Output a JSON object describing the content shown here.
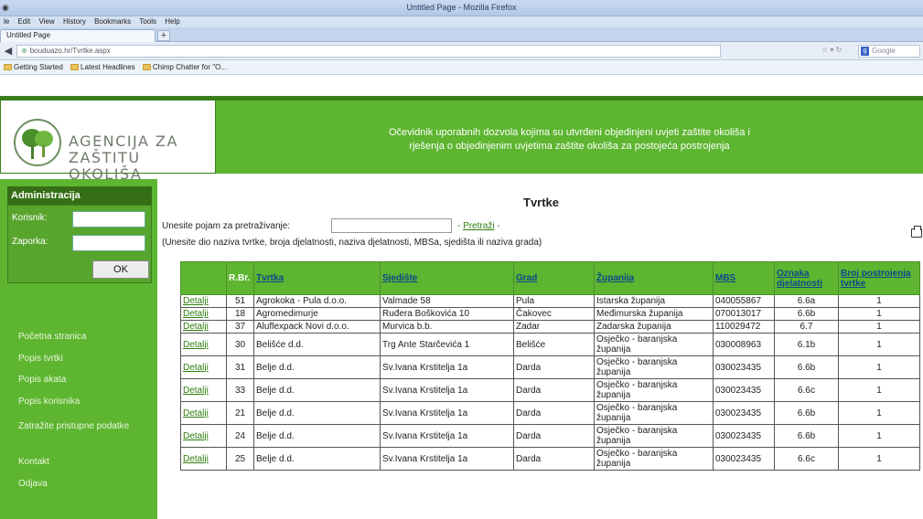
{
  "browser": {
    "window_title": "Untitled Page - Mozilla Firefox",
    "menu": [
      "le",
      "Edit",
      "View",
      "History",
      "Bookmarks",
      "Tools",
      "Help"
    ],
    "tab_label": "Untitled Page",
    "new_tab_label": "+",
    "url": "bouduazo.hr/Tvrtke.aspx",
    "search_engine": "Google",
    "bookmarks": [
      "Getting Started",
      "Latest Headlines",
      "Chimp Chatter for \"O..."
    ]
  },
  "header": {
    "logo_line1": "AGENCIJA ZA",
    "logo_line2": "ZAŠTITU OKOLIŠA",
    "banner_line1": "Očevidnik uporabnih dozvola kojima su utvrđeni objedinjeni uvjeti zaštite okoliša i",
    "banner_line2": "rješenja o objedinjenim uvjetima zaštite okoliša za postojeća postrojenja"
  },
  "sidebar": {
    "admin_title": "Administracija",
    "user_label": "Korisnik:",
    "password_label": "Zaporka:",
    "ok_label": "OK",
    "nav": [
      "Početna stranica",
      "Popis tvrtki",
      "Popis akata",
      "Popis korisnika",
      "Zatražite pristupne podatke",
      "Kontakt",
      "Odjava"
    ]
  },
  "main": {
    "title": "Tvrtke",
    "search_prompt": "Unesite pojam za pretraživanje:",
    "search_button": "Pretraži",
    "search_hint": "(Unesite dio naziva tvrtke, broja djelatnosti, naziva djelatnosti, MBSa, sjedišta ili naziva grada)"
  },
  "table": {
    "headers": [
      "",
      "R.Br.",
      "Tvrtka",
      "Sjedište",
      "Grad",
      "Županija",
      "MBS",
      "Oznaka djelatnosti",
      "Broj postrojenja tvrtke"
    ],
    "rows": [
      [
        "Detalji",
        "51",
        "Agrokoka - Pula d.o.o.",
        "Valmade 58",
        "Pula",
        "Istarska županija",
        "040055867",
        "6.6a",
        "1"
      ],
      [
        "Detalji",
        "18",
        "Agromedimurje",
        "Ruđera Boškovića 10",
        "Čakovec",
        "Međimurska županija",
        "070013017",
        "6.6b",
        "1"
      ],
      [
        "Detalji",
        "37",
        "Aluflexpack Novi d.o.o.",
        "Murvica b.b.",
        "Zadar",
        "Zadarska županija",
        "110029472",
        "6.7",
        "1"
      ],
      [
        "Detalji",
        "30",
        "Belišće d.d.",
        "Trg Ante Starčevića 1",
        "Belišće",
        "Osječko - baranjska županija",
        "030008963",
        "6.1b",
        "1"
      ],
      [
        "Detalji",
        "31",
        "Belje d.d.",
        "Sv.Ivana Krstitelja 1a",
        "Darda",
        "Osječko - baranjska županija",
        "030023435",
        "6.6b",
        "1"
      ],
      [
        "Detalji",
        "33",
        "Belje d.d.",
        "Sv.Ivana Krstitelja 1a",
        "Darda",
        "Osječko - baranjska županija",
        "030023435",
        "6.6c",
        "1"
      ],
      [
        "Detalji",
        "21",
        "Belje d.d.",
        "Sv.Ivana Krstitelja 1a",
        "Darda",
        "Osječko - baranjska županija",
        "030023435",
        "6.6b",
        "1"
      ],
      [
        "Detalji",
        "24",
        "Belje d.d.",
        "Sv.Ivana Krstitelja 1a",
        "Darda",
        "Osječko - baranjska županija",
        "030023435",
        "6.6b",
        "1"
      ],
      [
        "Detalji",
        "25",
        "Belje d.d.",
        "Sv.Ivana Krstitelja 1a",
        "Darda",
        "Osječko - baranjska županija",
        "030023435",
        "6.6c",
        "1"
      ]
    ]
  },
  "colors": {
    "brand_green": "#5db530",
    "dark_green": "#356f15"
  }
}
